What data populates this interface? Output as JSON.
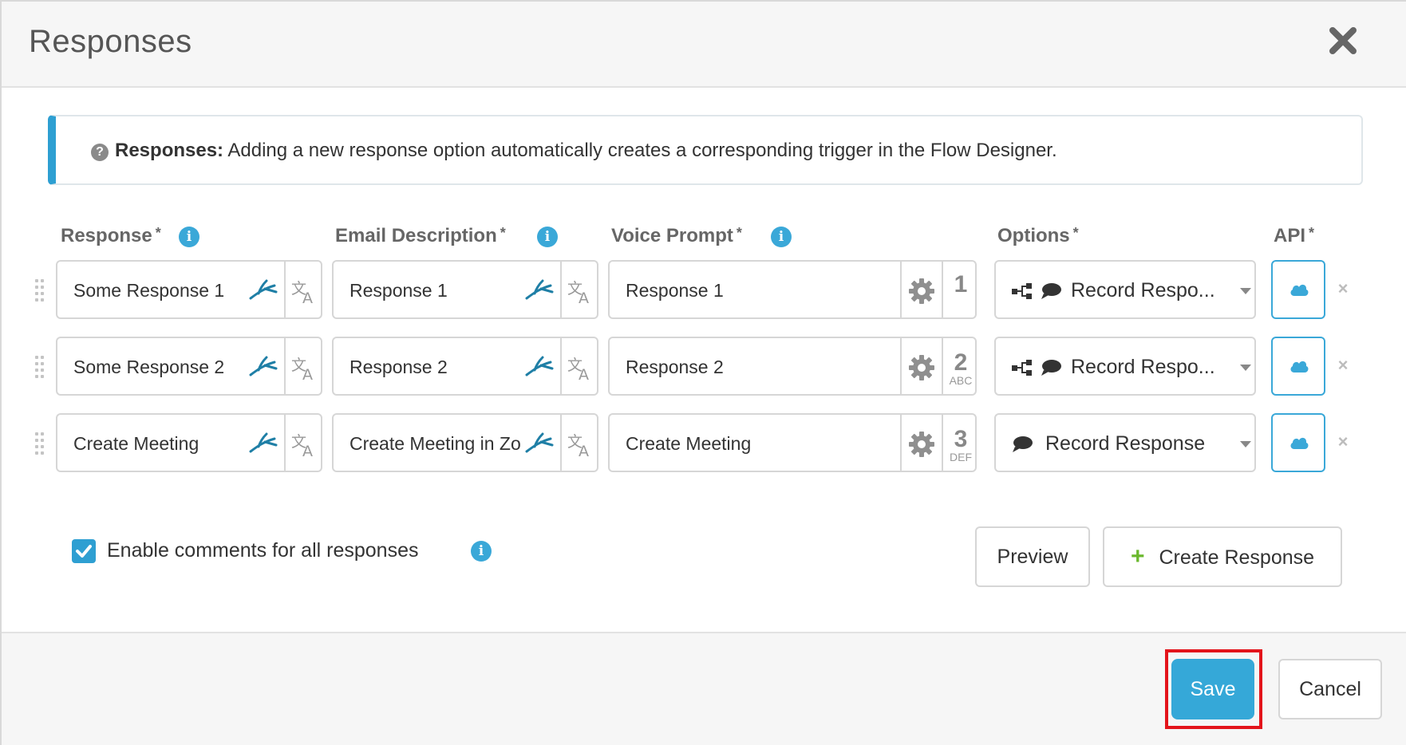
{
  "dialog": {
    "title": "Responses",
    "close_icon": "close-icon"
  },
  "notice": {
    "label": "Responses:",
    "text": "Adding a new response option automatically creates a corresponding trigger in the Flow Designer."
  },
  "columns": {
    "response": "Response",
    "email": "Email Description",
    "voice": "Voice Prompt",
    "options": "Options",
    "api": "API",
    "required_mark": "*"
  },
  "rows": [
    {
      "response": "Some Response 1",
      "email": "Response 1",
      "voice": "Response 1",
      "key_number": "1",
      "key_letters": "",
      "option": "Record Respo...",
      "has_flow_icon": true
    },
    {
      "response": "Some Response 2",
      "email": "Response 2",
      "voice": "Response 2",
      "key_number": "2",
      "key_letters": "ABC",
      "option": "Record Respo...",
      "has_flow_icon": true
    },
    {
      "response": "Create Meeting",
      "email": "Create Meeting in Zo",
      "voice": "Create Meeting",
      "key_number": "3",
      "key_letters": "DEF",
      "option": "Record Response",
      "has_flow_icon": false
    }
  ],
  "comments": {
    "label": "Enable comments for all responses",
    "checked": true
  },
  "buttons": {
    "preview": "Preview",
    "create_response_plus": "+",
    "create_response": "Create Response",
    "save": "Save",
    "cancel": "Cancel"
  },
  "colors": {
    "accent": "#35a8d8",
    "notice_border": "#2e9fd2",
    "plus": "#6ab82d",
    "highlight": "#e3141b"
  }
}
